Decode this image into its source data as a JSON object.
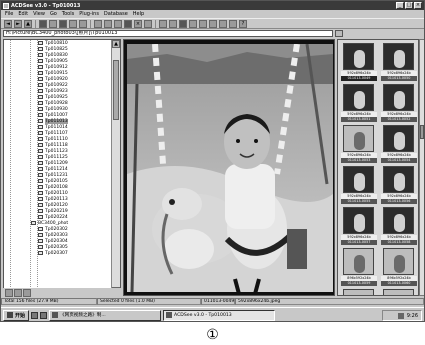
{
  "window": {
    "title": "ACDSee v3.0 - Tp010013"
  },
  "menu": [
    "File",
    "Edit",
    "View",
    "Go",
    "Tools",
    "Plug-ins",
    "Database",
    "Help"
  ],
  "address": {
    "value": "H:\\Picture\\BC3400_photo03\\[照片]\\Tp010013"
  },
  "tree": {
    "items": [
      "Tp010810",
      "Tp010825",
      "Tp010830",
      "Tp010905",
      "Tp010912",
      "Tp010915",
      "Tp010920",
      "Tp010922",
      "Tp010923",
      "Tp010925",
      "Tp010928",
      "Tp010930",
      "Tp011007",
      "Tp011013",
      "Tp011014",
      "Tp011107",
      "Tp011110",
      "Tp011118",
      "Tp011123",
      "Tp011125",
      "Tp011209",
      "Tp011214",
      "Tp011231",
      "Tp020105",
      "Tp020108",
      "Tp020110",
      "Tp020113",
      "Tp020120",
      "Tp020219",
      "Tp020224",
      "BC3400_phot",
      "Tp020302",
      "Tp020303",
      "Tp020304",
      "Tp020305",
      "Tp020307"
    ],
    "selected_index": 13
  },
  "thumbnails": [
    {
      "info": "592x896x24b",
      "name": "011013-0049",
      "tone": "dark"
    },
    {
      "info": "592x896x24b",
      "name": "011013-0050",
      "tone": "dark"
    },
    {
      "info": "592x896x24b",
      "name": "011013-0051",
      "tone": "dark"
    },
    {
      "info": "592x896x24b",
      "name": "011013-0052",
      "tone": "dark"
    },
    {
      "info": "592x896x24b",
      "name": "011013-0053",
      "tone": "light"
    },
    {
      "info": "592x896x24b",
      "name": "011013-0054",
      "tone": "dark"
    },
    {
      "info": "592x896x24b",
      "name": "011013-0055",
      "tone": "dark"
    },
    {
      "info": "592x896x24b",
      "name": "011013-0056",
      "tone": "dark"
    },
    {
      "info": "592x896x24b",
      "name": "011013-0057",
      "tone": "dark"
    },
    {
      "info": "592x896x24b",
      "name": "011013-0058",
      "tone": "dark"
    },
    {
      "info": "896x592x24b",
      "name": "011013-0059",
      "tone": "light"
    },
    {
      "info": "896x592x24b",
      "name": "011013-0060",
      "tone": "light"
    },
    {
      "info": "",
      "name": "",
      "tone": "light"
    },
    {
      "info": "",
      "name": "",
      "tone": "light"
    }
  ],
  "status": {
    "total": "Total 156 files (27.9 MB)",
    "selected": "Selected 0 files (1.0 MB)",
    "file": "011013-0049",
    "dims": "592x896x24b.jpeg"
  },
  "taskbar": {
    "start_label": "开始",
    "tasks": [
      "《网页视频之路》制...",
      "ACDSee v3.0 - Tp010013"
    ],
    "clock": "9:26"
  },
  "caption": "①"
}
